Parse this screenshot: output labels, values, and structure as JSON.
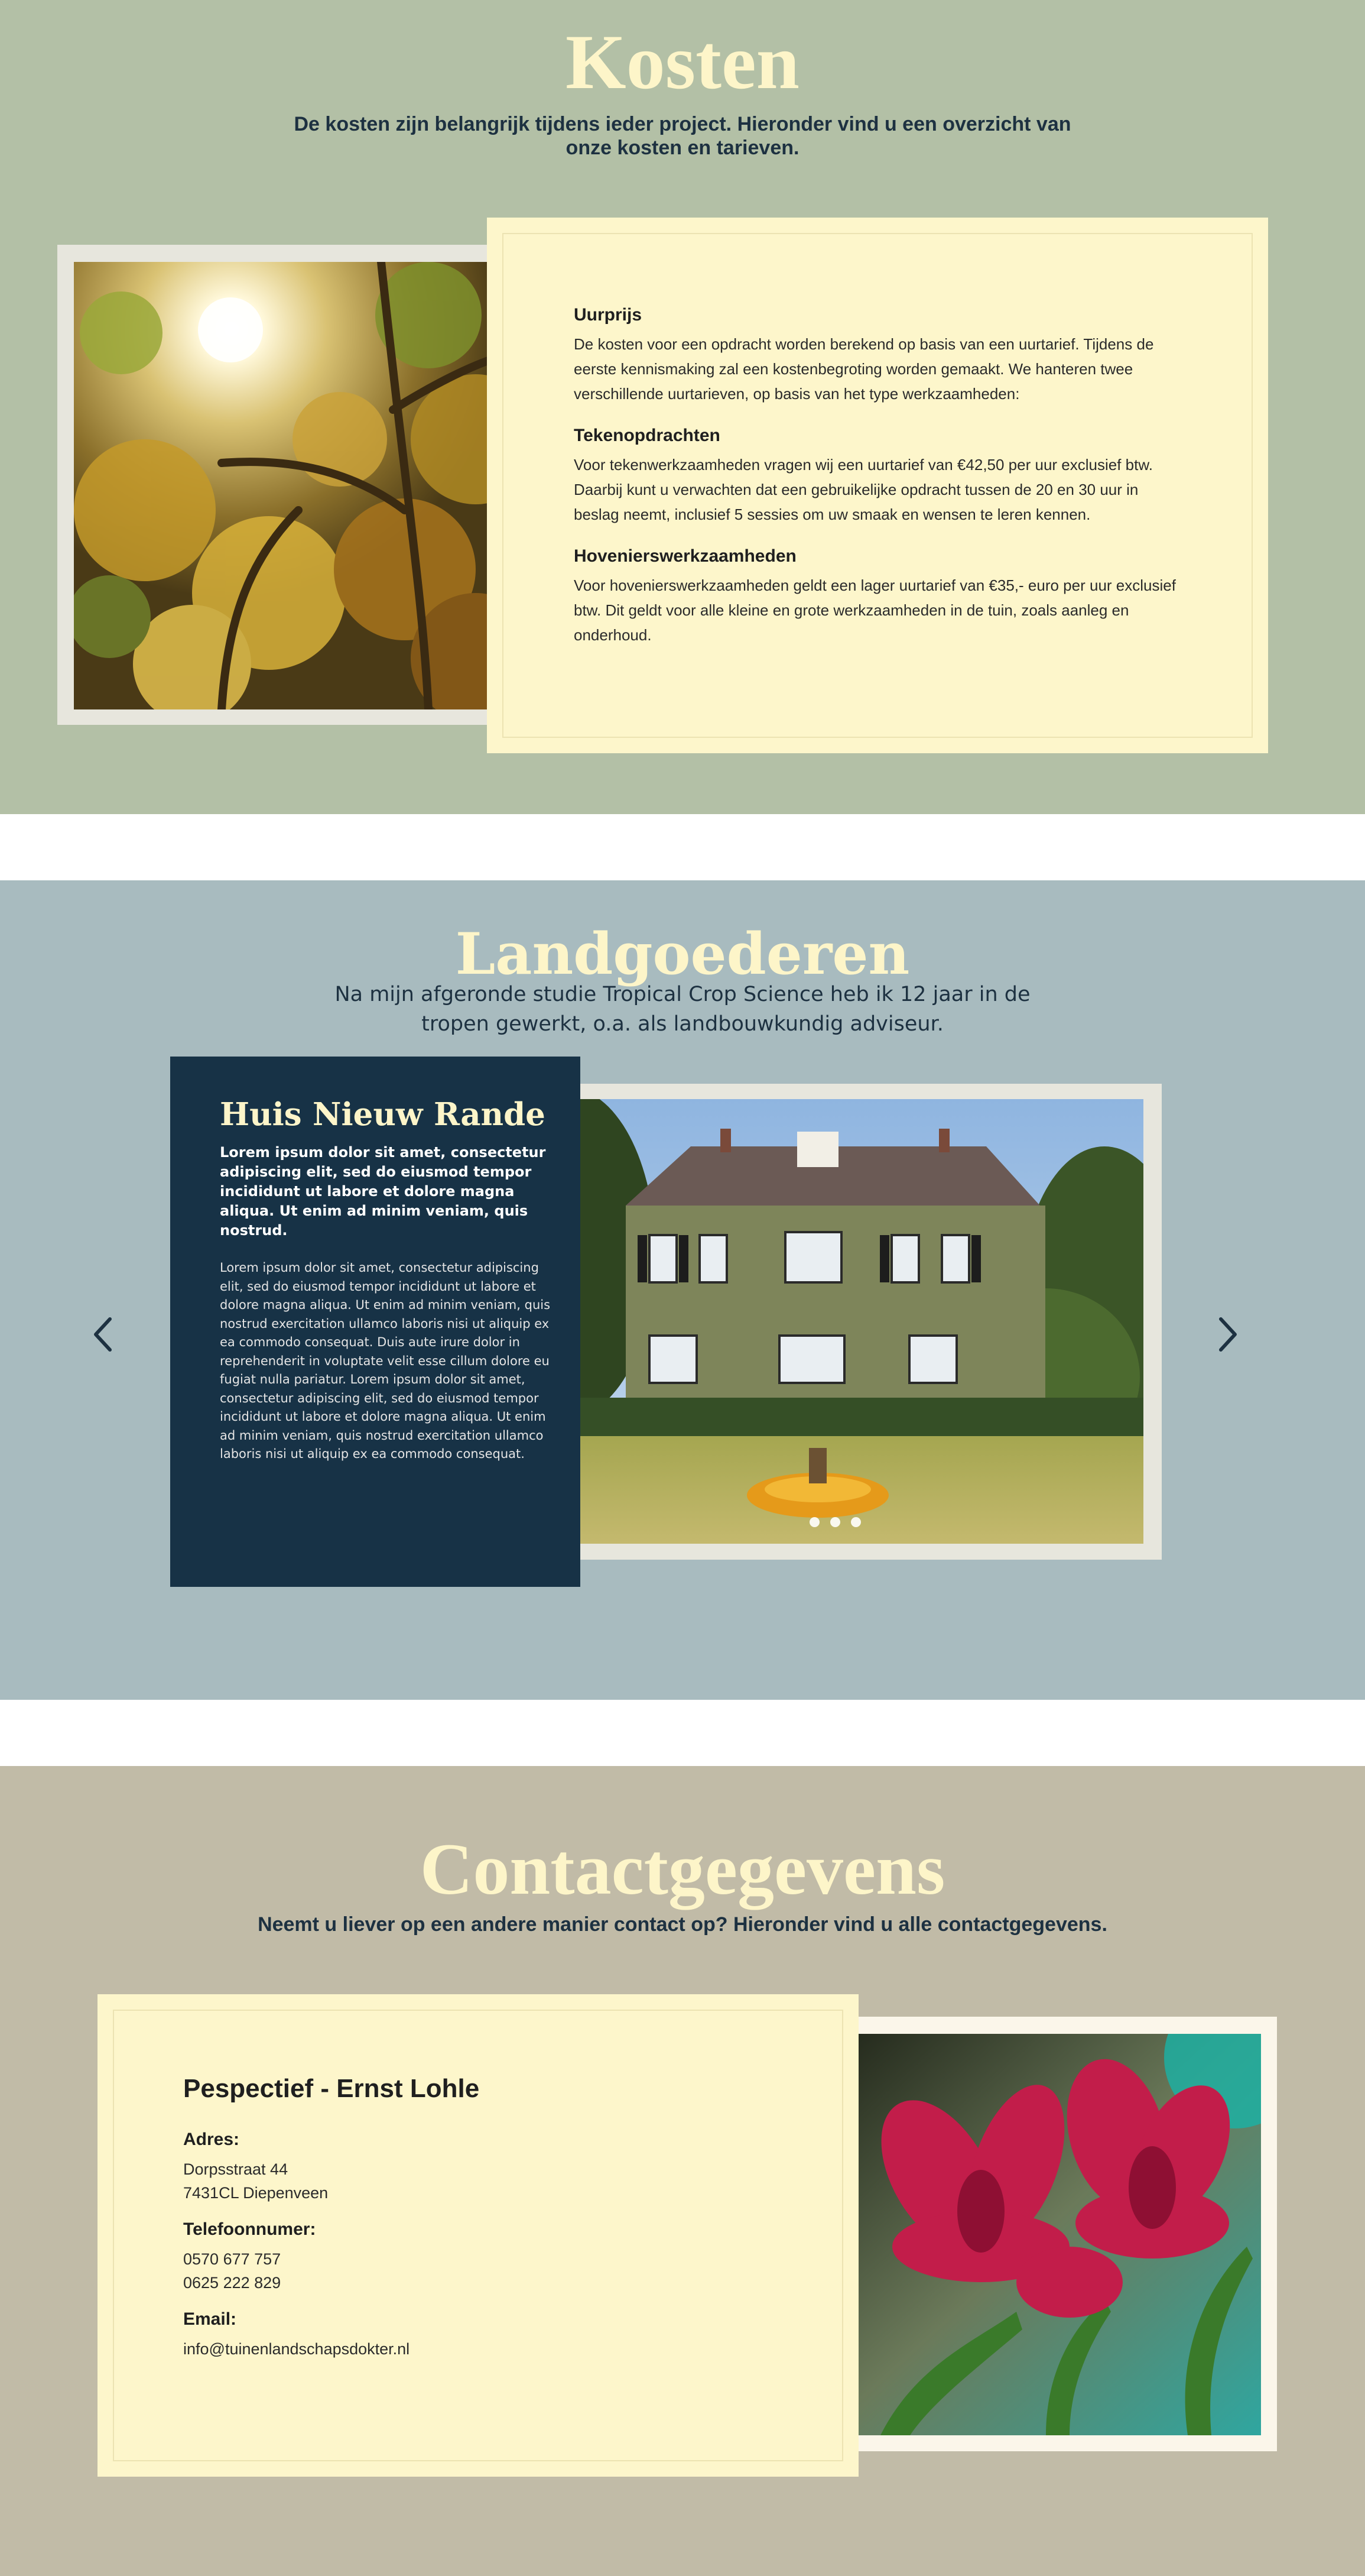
{
  "kosten": {
    "title": "Kosten",
    "subtitle": "De kosten zijn belangrijk tijdens ieder project. Hieronder vind u een overzicht van onze kosten en tarieven.",
    "image_alt": "Herfstbladeren in zonlicht",
    "blocks": [
      {
        "heading": "Uurprijs",
        "text": "De kosten voor een opdracht worden berekend op basis van een uurtarief. Tijdens de eerste kennismaking zal een kostenbegroting worden gemaakt. We hanteren twee verschillende uurtarieven, op basis van het type werkzaamheden:"
      },
      {
        "heading": "Tekenopdrachten",
        "text": "Voor tekenwerkzaamheden vragen wij een uurtarief van €42,50 per uur exclusief btw. Daarbij kunt u verwachten dat een gebruikelijke opdracht tussen de 20 en 30 uur in beslag neemt, inclusief 5 sessies om uw smaak en wensen te leren kennen."
      },
      {
        "heading": "Hovenierswerkzaamheden",
        "text": "Voor hovenierswerkzaamheden geldt een lager uurtarief van €35,- euro per uur exclusief btw. Dit geldt voor alle kleine en grote werkzaamheden in de tuin, zoals aanleg en onderhoud."
      }
    ]
  },
  "landgoederen": {
    "title": "Landgoederen",
    "subtitle": "Na mijn afgeronde studie Tropical Crop Science heb ik 12 jaar in de tropen gewerkt, o.a. als landbouwkundig adviseur.",
    "slide": {
      "title": "Huis Nieuw Rande",
      "lead": "Lorem ipsum dolor sit amet, consectetur adipiscing elit, sed do eiusmod tempor incididunt ut labore et dolore magna aliqua. Ut enim ad minim veniam, quis nostrud.",
      "body": "Lorem ipsum dolor sit amet, consectetur adipiscing elit, sed do eiusmod tempor incididunt ut labore et dolore magna aliqua. Ut enim ad minim veniam, quis nostrud exercitation ullamco laboris nisi ut aliquip ex ea commodo consequat. Duis aute irure dolor in reprehenderit in voluptate velit esse cillum dolore eu fugiat nulla pariatur. Lorem ipsum dolor sit amet, consectetur adipiscing elit, sed do eiusmod tempor incididunt ut labore et dolore magna aliqua. Ut enim ad minim veniam, quis nostrud exercitation ullamco laboris nisi ut aliquip ex ea commodo consequat."
    },
    "prev_icon": "chevron-left-icon",
    "next_icon": "chevron-right-icon",
    "dots_count": 3
  },
  "contact": {
    "title": "Contactgegevens",
    "subtitle": "Neemt u liever op een andere manier contact op? Hieronder vind u alle contactgegevens.",
    "name": "Pespectief - Ernst Lohle",
    "address_label": "Adres:",
    "address_line1": "Dorpsstraat 44",
    "address_line2": "7431CL Diepenveen",
    "phone_label": "Telefoonnumer:",
    "phone1": "0570 677 757",
    "phone2": "0625 222 829",
    "email_label": "Email:",
    "email": "info@tuinenlandschapsdokter.nl"
  },
  "colors": {
    "kosten_bg": "#b3c0a6",
    "land_bg": "#a8bbbf",
    "contact_bg": "#c1bba7",
    "cream": "#fdf6cb",
    "navy": "#173246"
  }
}
